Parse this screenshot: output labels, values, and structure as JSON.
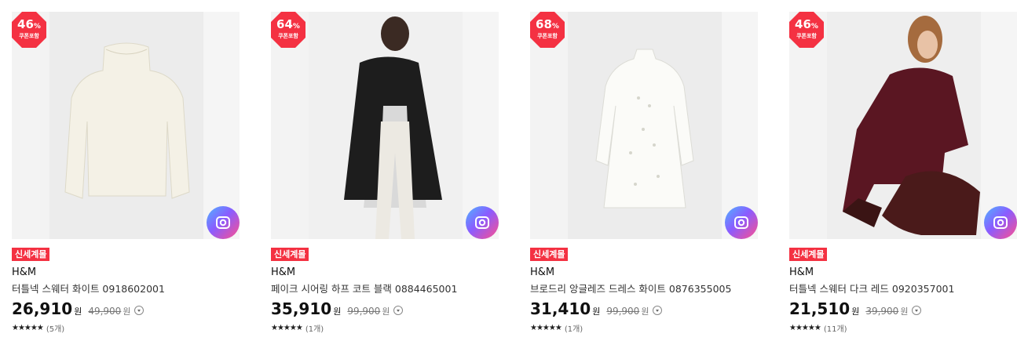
{
  "colors": {
    "badge": "#f43142",
    "tag": "#f43142"
  },
  "products": [
    {
      "badge_percent": "46",
      "badge_percent_unit": "%",
      "badge_sub": "쿠폰포함",
      "tag": "신세계몰",
      "brand": "H&M",
      "title": "터틀넥 스웨터 화이트 0918602001",
      "price": "26,910",
      "price_unit": "원",
      "original_price": "49,900",
      "original_unit": "원",
      "stars": "★★★★★",
      "review_count": "(5개)",
      "rating": 5,
      "image_icon": "camera-lens-icon"
    },
    {
      "badge_percent": "64",
      "badge_percent_unit": "%",
      "badge_sub": "쿠폰포함",
      "tag": "신세계몰",
      "brand": "H&M",
      "title": "페이크 시어링 하프 코트 블랙 0884465001",
      "price": "35,910",
      "price_unit": "원",
      "original_price": "99,900",
      "original_unit": "원",
      "stars": "★★★★★",
      "review_count": "(1개)",
      "rating": 5,
      "image_icon": "camera-lens-icon"
    },
    {
      "badge_percent": "68",
      "badge_percent_unit": "%",
      "badge_sub": "쿠폰포함",
      "tag": "신세계몰",
      "brand": "H&M",
      "title": "브로드리 앙글레즈 드레스 화이트 0876355005",
      "price": "31,410",
      "price_unit": "원",
      "original_price": "99,900",
      "original_unit": "원",
      "stars": "★★★★★",
      "review_count": "(1개)",
      "rating": 5,
      "image_icon": "camera-lens-icon"
    },
    {
      "badge_percent": "46",
      "badge_percent_unit": "%",
      "badge_sub": "쿠폰포함",
      "tag": "신세계몰",
      "brand": "H&M",
      "title": "터틀넥 스웨터 다크 레드 0920357001",
      "price": "21,510",
      "price_unit": "원",
      "original_price": "39,900",
      "original_unit": "원",
      "stars": "★★★★★",
      "review_count": "(11개)",
      "rating": 4.5,
      "image_icon": "camera-lens-icon"
    }
  ]
}
